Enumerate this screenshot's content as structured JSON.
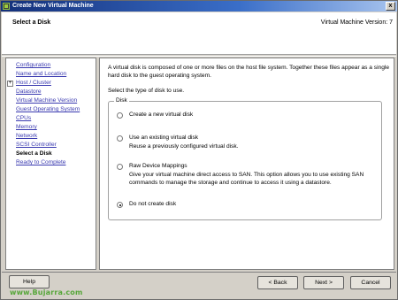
{
  "window": {
    "title": "Create New Virtual Machine",
    "close_glyph": "x"
  },
  "header": {
    "step_title": "Select a Disk",
    "vm_version": "Virtual Machine Version: 7"
  },
  "nav": {
    "items": [
      {
        "label": "Configuration",
        "state": "link"
      },
      {
        "label": "Name and Location",
        "state": "link"
      },
      {
        "label": "Host / Cluster",
        "state": "link",
        "expander": "+"
      },
      {
        "label": "Datastore",
        "state": "link"
      },
      {
        "label": "Virtual Machine Version",
        "state": "link"
      },
      {
        "label": "Guest Operating System",
        "state": "link"
      },
      {
        "label": "CPUs",
        "state": "link"
      },
      {
        "label": "Memory",
        "state": "link"
      },
      {
        "label": "Network",
        "state": "link"
      },
      {
        "label": "SCSI Controller",
        "state": "link"
      },
      {
        "label": "Select a Disk",
        "state": "current"
      },
      {
        "label": "Ready to Complete",
        "state": "link"
      }
    ]
  },
  "content": {
    "intro": "A virtual disk is composed of one or more files on the host file system. Together these files appear as a single hard disk to the guest operating system.",
    "instruction": "Select the type of disk to use.",
    "group_label": "Disk",
    "options": [
      {
        "label": "Create a new virtual disk",
        "description": "",
        "checked": false
      },
      {
        "label": "Use an existing virtual disk",
        "description": "Reuse a previously configured virtual disk.",
        "checked": false
      },
      {
        "label": "Raw Device Mappings",
        "description": "Give your virtual machine direct access to SAN. This option allows you to use existing SAN commands to manage the storage and continue to access it using a datastore.",
        "checked": false
      },
      {
        "label": "Do not create disk",
        "description": "",
        "checked": true
      }
    ]
  },
  "buttons": {
    "help": "Help",
    "back": "< Back",
    "next": "Next >",
    "cancel": "Cancel"
  },
  "watermark": "www.Bujarra.com"
}
